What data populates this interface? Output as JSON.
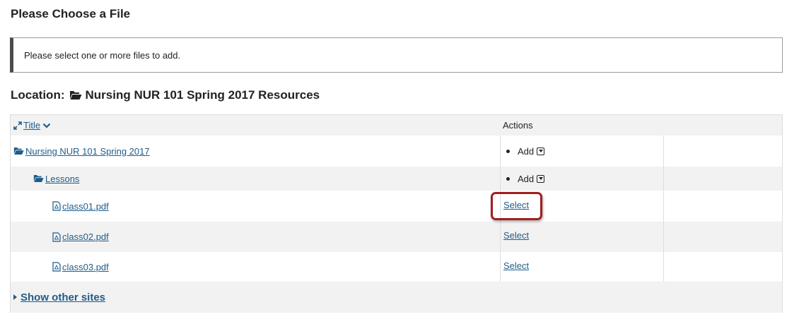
{
  "page": {
    "title": "Please Choose a File",
    "instructions": "Please select one or more files to add.",
    "location_label": "Location:",
    "location_name": "Nursing NUR 101 Spring 2017 Resources"
  },
  "table": {
    "col_title": "Title",
    "col_actions": "Actions",
    "rows": [
      {
        "name": "Nursing NUR 101 Spring 2017",
        "type": "folder",
        "action": "Add"
      },
      {
        "name": "Lessons",
        "type": "folder",
        "action": "Add"
      },
      {
        "name": "class01.pdf",
        "type": "pdf",
        "action": "Select"
      },
      {
        "name": "class02.pdf",
        "type": "pdf",
        "action": "Select"
      },
      {
        "name": "class03.pdf",
        "type": "pdf",
        "action": "Select"
      }
    ]
  },
  "footer": {
    "show_other_sites": "Show other sites"
  },
  "colors": {
    "link": "#1f5c8a",
    "highlight": "#a31d1d",
    "row_shade": "#f2f2f2"
  }
}
